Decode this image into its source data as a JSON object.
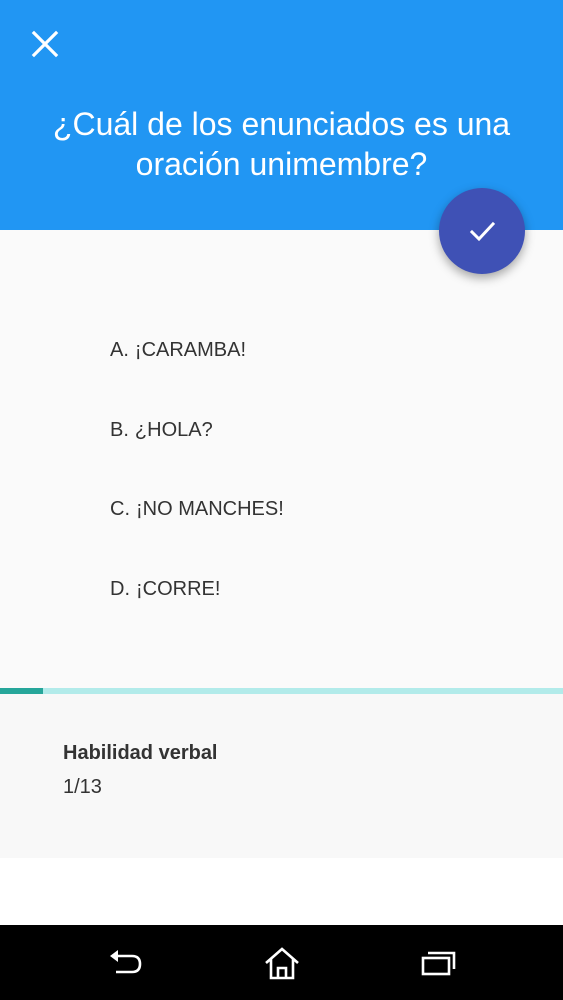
{
  "header": {
    "question": "¿Cuál de los enunciados es una oración unimembre?",
    "background_color": "#2196F3",
    "close_icon": "close-icon"
  },
  "fab": {
    "icon": "check-icon",
    "color": "#3F51B5"
  },
  "options": [
    {
      "letter": "A.",
      "text": "¡CARAMBA!"
    },
    {
      "letter": "B.",
      "text": "¿HOLA?"
    },
    {
      "letter": "C.",
      "text": "¡NO MANCHES!"
    },
    {
      "letter": "D.",
      "text": "¡CORRE!"
    }
  ],
  "progress": {
    "current": 1,
    "total": 13,
    "fill_color": "#26A69A",
    "track_color": "#B2EBEA"
  },
  "info": {
    "subject": "Habilidad verbal",
    "counter": "1/13"
  },
  "navbar": {
    "back_icon": "back-icon",
    "home_icon": "home-icon",
    "recents_icon": "recents-icon"
  }
}
